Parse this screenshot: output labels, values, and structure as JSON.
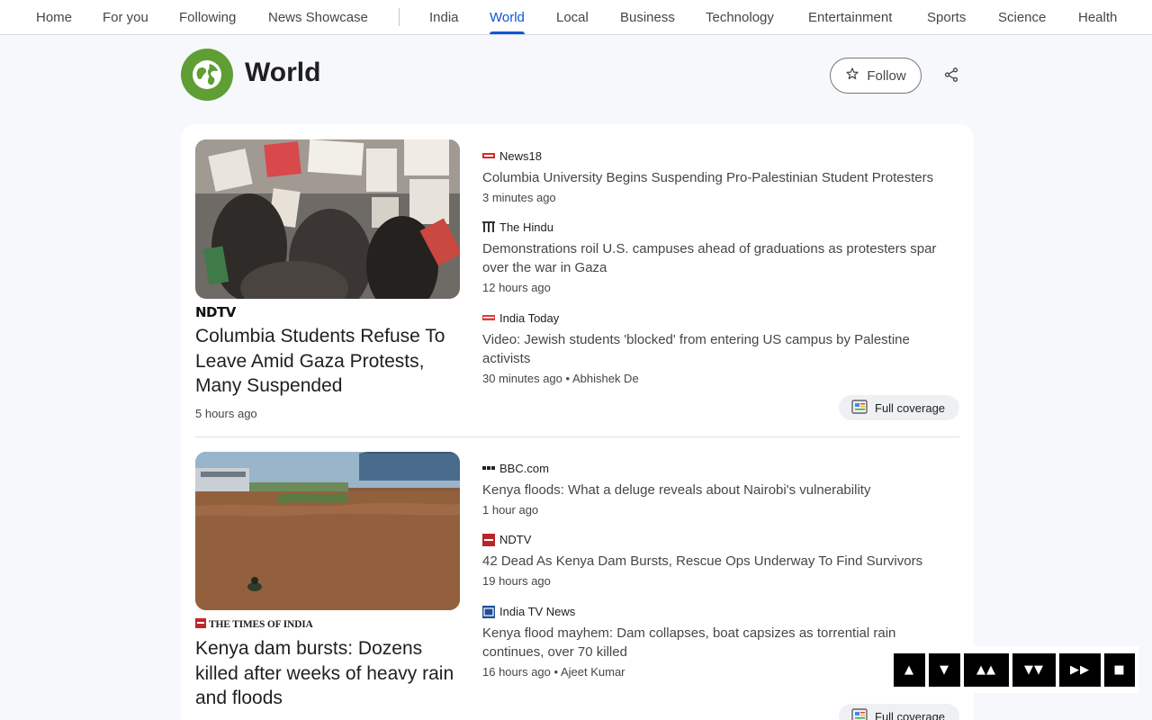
{
  "nav": {
    "items": [
      "Home",
      "For you",
      "Following",
      "News Showcase",
      "India",
      "World",
      "Local",
      "Business",
      "Technology",
      "Entertainment",
      "Sports",
      "Science",
      "Health"
    ],
    "active": "World"
  },
  "header": {
    "title": "World",
    "follow_label": "Follow",
    "icons": {
      "topic": "globe-icon",
      "follow": "star-icon",
      "share": "share-icon"
    }
  },
  "stories": [
    {
      "hero": {
        "source": "NDTV",
        "title": "Columbia Students Refuse To Leave Amid Gaza Protests, Many Suspended",
        "time": "5 hours ago"
      },
      "articles": [
        {
          "source": "News18",
          "title": "Columbia University Begins Suspending Pro-Palestinian Student Protesters",
          "time": "3 minutes ago",
          "author": ""
        },
        {
          "source": "The Hindu",
          "title": "Demonstrations roil U.S. campuses ahead of graduations as protesters spar over the war in Gaza",
          "time": "12 hours ago",
          "author": ""
        },
        {
          "source": "India Today",
          "title": "Video: Jewish students 'blocked' from entering US campus by Palestine activists",
          "time": "30 minutes ago",
          "author": "Abhishek De"
        }
      ],
      "full_coverage": "Full coverage"
    },
    {
      "hero": {
        "source": "THE TIMES OF INDIA",
        "title": "Kenya dam bursts: Dozens killed after weeks of heavy rain and floods",
        "time": ""
      },
      "articles": [
        {
          "source": "BBC.com",
          "title": "Kenya floods: What a deluge reveals about Nairobi's vulnerability",
          "time": "1 hour ago",
          "author": ""
        },
        {
          "source": "NDTV",
          "title": "42 Dead As Kenya Dam Bursts, Rescue Ops Underway To Find Survivors",
          "time": "19 hours ago",
          "author": ""
        },
        {
          "source": "India TV News",
          "title": "Kenya flood mayhem: Dam collapses, boat capsizes as torrential rain continues, over 70 killed",
          "time": "16 hours ago",
          "author": "Ajeet Kumar"
        }
      ],
      "full_coverage": "Full coverage"
    }
  ],
  "controls": [
    "▲",
    "▼",
    "▲▲",
    "▼▼",
    "▶▶",
    "■"
  ],
  "colors": {
    "accent": "#0b57d0",
    "topic_logo": "#5f9e34"
  }
}
